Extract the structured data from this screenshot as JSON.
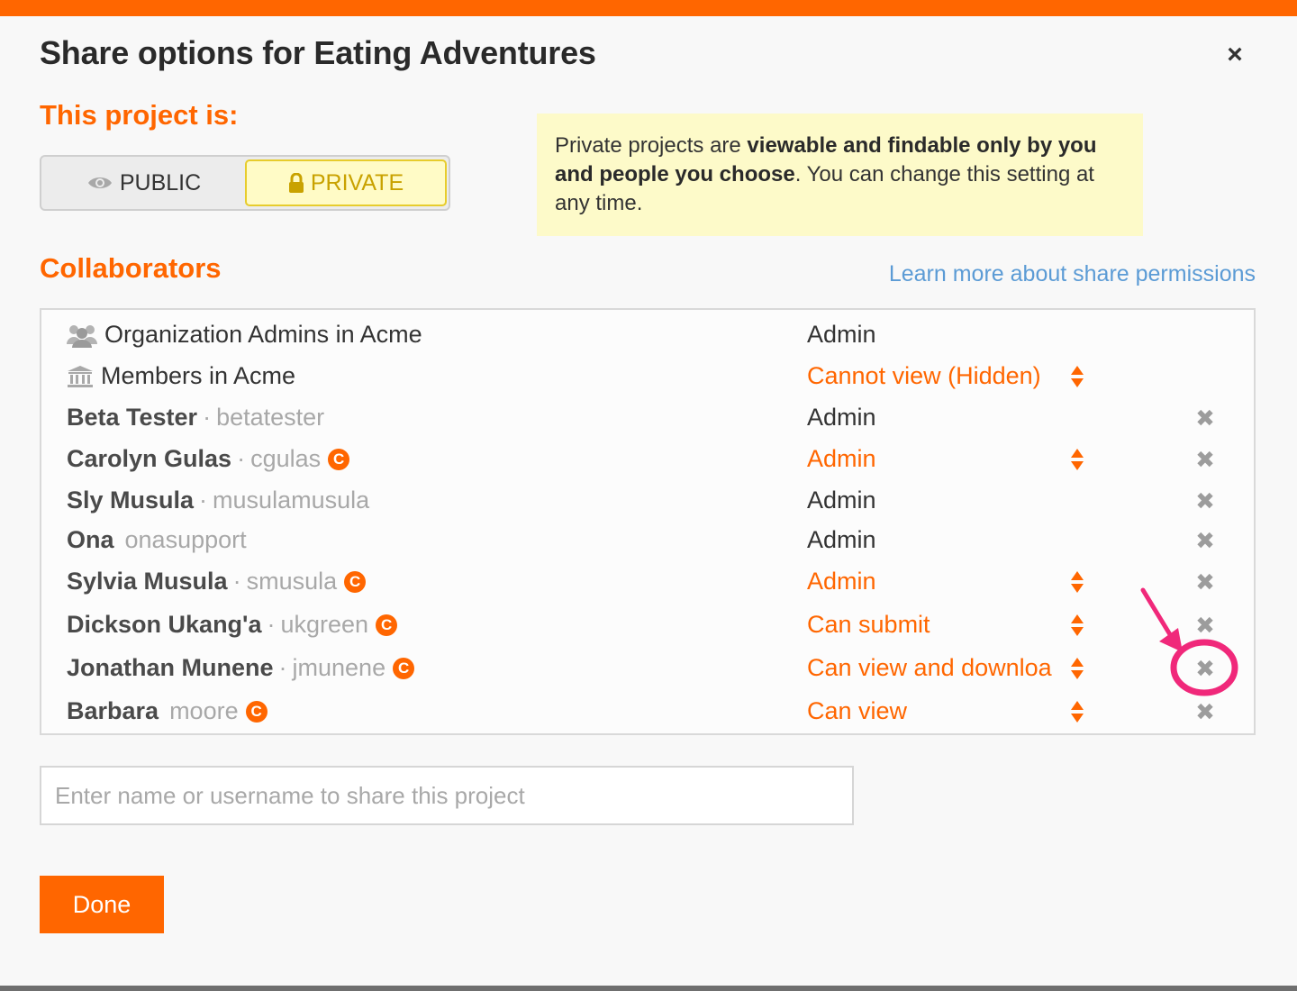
{
  "dialog": {
    "title": "Share options for Eating Adventures",
    "close_icon": "close-icon"
  },
  "visibility": {
    "heading": "This project is:",
    "public_label": "PUBLIC",
    "private_label": "PRIVATE",
    "selected": "PRIVATE",
    "public_icon": "eye-icon",
    "private_icon": "lock-icon",
    "note_part1": "Private projects are ",
    "note_bold": "viewable and findable only by you and people you choose",
    "note_part2": ". You can change this setting at any time."
  },
  "collaborators": {
    "heading": "Collaborators",
    "learn_more": "Learn more about share permissions",
    "groups": [
      {
        "name": "Organization Admins in Acme",
        "permission": "Admin",
        "icon": "users-icon"
      },
      {
        "name": "Members in Acme",
        "permission": "Cannot view (Hidden)",
        "icon": "institution-icon"
      }
    ],
    "users": [
      {
        "name": "Beta Tester",
        "sep": "·",
        "username": "betatester",
        "badge": "",
        "permission": "Admin"
      },
      {
        "name": "Carolyn Gulas",
        "sep": "·",
        "username": "cgulas",
        "badge": "C",
        "permission": "Admin"
      },
      {
        "name": "Sly Musula",
        "sep": "·",
        "username": "musulamusula",
        "badge": "",
        "permission": "Admin"
      },
      {
        "name": "Ona",
        "sep": "",
        "username": "onasupport",
        "badge": "",
        "permission": "Admin"
      },
      {
        "name": "Sylvia Musula",
        "sep": "·",
        "username": "smusula",
        "badge": "C",
        "permission": "Admin"
      },
      {
        "name": "Dickson Ukang'a",
        "sep": "·",
        "username": "ukgreen",
        "badge": "C",
        "permission": "Can submit"
      },
      {
        "name": "Jonathan Munene",
        "sep": "·",
        "username": "jmunene",
        "badge": "C",
        "permission": "Can view and downloa"
      },
      {
        "name": "Barbara",
        "sep": "",
        "username": "moore",
        "badge": "C",
        "permission": "Can view"
      }
    ]
  },
  "share_input": {
    "placeholder": "Enter name or username to share this project",
    "value": ""
  },
  "done_label": "Done",
  "colors": {
    "accent": "#ff6600",
    "link": "#5b9bd5",
    "note_bg": "#fdfac9",
    "annotation": "#f0287a"
  }
}
